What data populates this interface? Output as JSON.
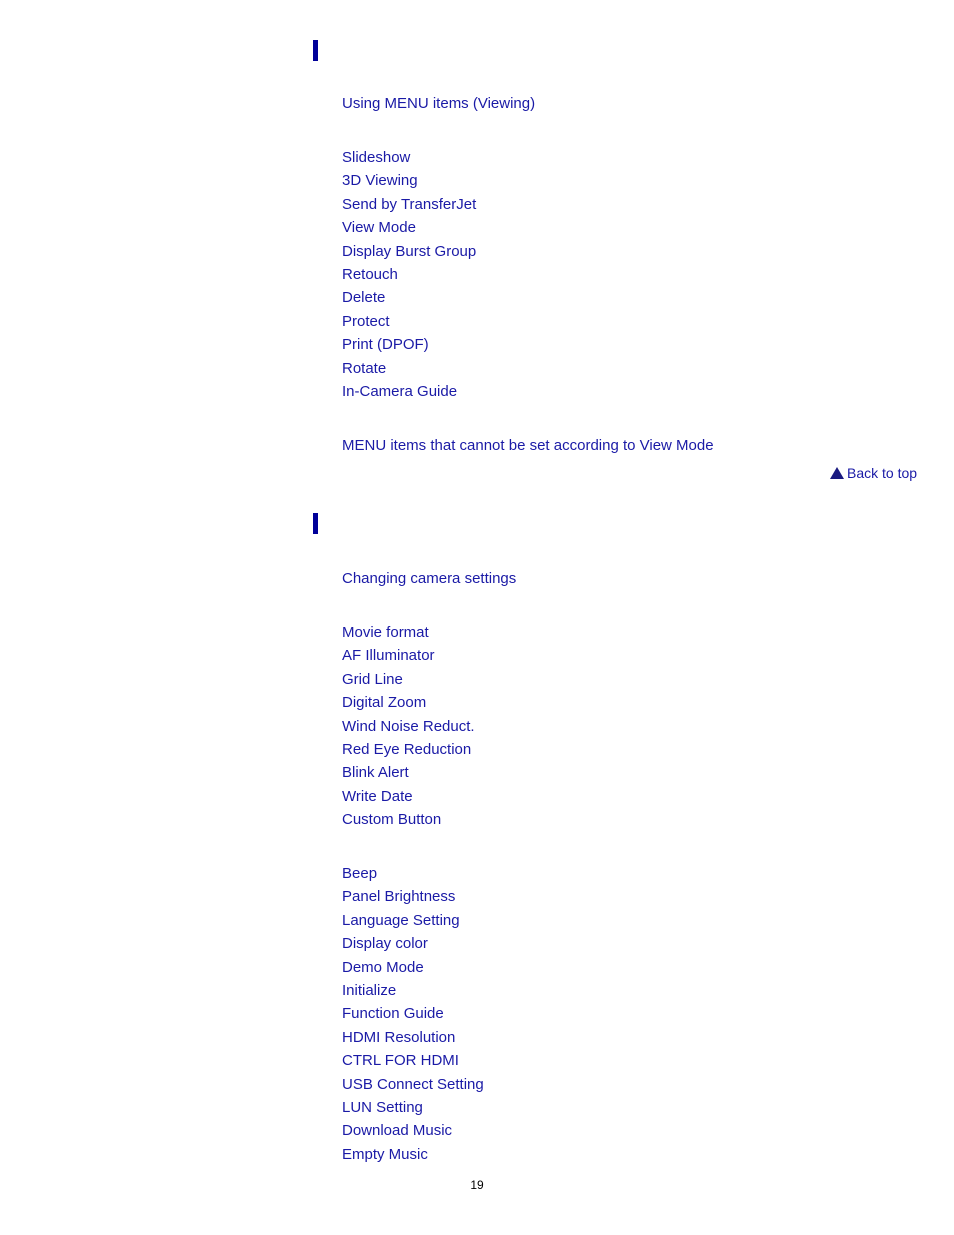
{
  "section1": {
    "heading_link": "Using MENU items (Viewing)",
    "items": [
      "Slideshow",
      "3D Viewing",
      "Send by TransferJet",
      "View Mode",
      "Display Burst Group",
      "Retouch",
      "Delete",
      "Protect",
      "Print (DPOF)",
      "Rotate",
      "In-Camera Guide"
    ],
    "footer_link": "MENU items that cannot be set according to View Mode"
  },
  "back_to_top": {
    "icon": "triangle-up-icon",
    "label": "Back to top"
  },
  "section2": {
    "heading_link": "Changing camera settings",
    "camera_items": [
      "Movie format",
      "AF Illuminator",
      "Grid Line",
      "Digital Zoom",
      "Wind Noise Reduct.",
      "Red Eye Reduction",
      "Blink Alert",
      "Write Date",
      "Custom Button"
    ],
    "main_items": [
      "Beep",
      "Panel Brightness",
      "Language Setting",
      "Display color",
      "Demo Mode",
      "Initialize",
      "Function Guide",
      "HDMI Resolution",
      "CTRL FOR HDMI",
      "USB Connect Setting",
      "LUN Setting",
      "Download Music",
      "Empty Music"
    ]
  },
  "page_number": "19",
  "colors": {
    "link": "#1a1aa6",
    "section_bar": "#000099"
  }
}
